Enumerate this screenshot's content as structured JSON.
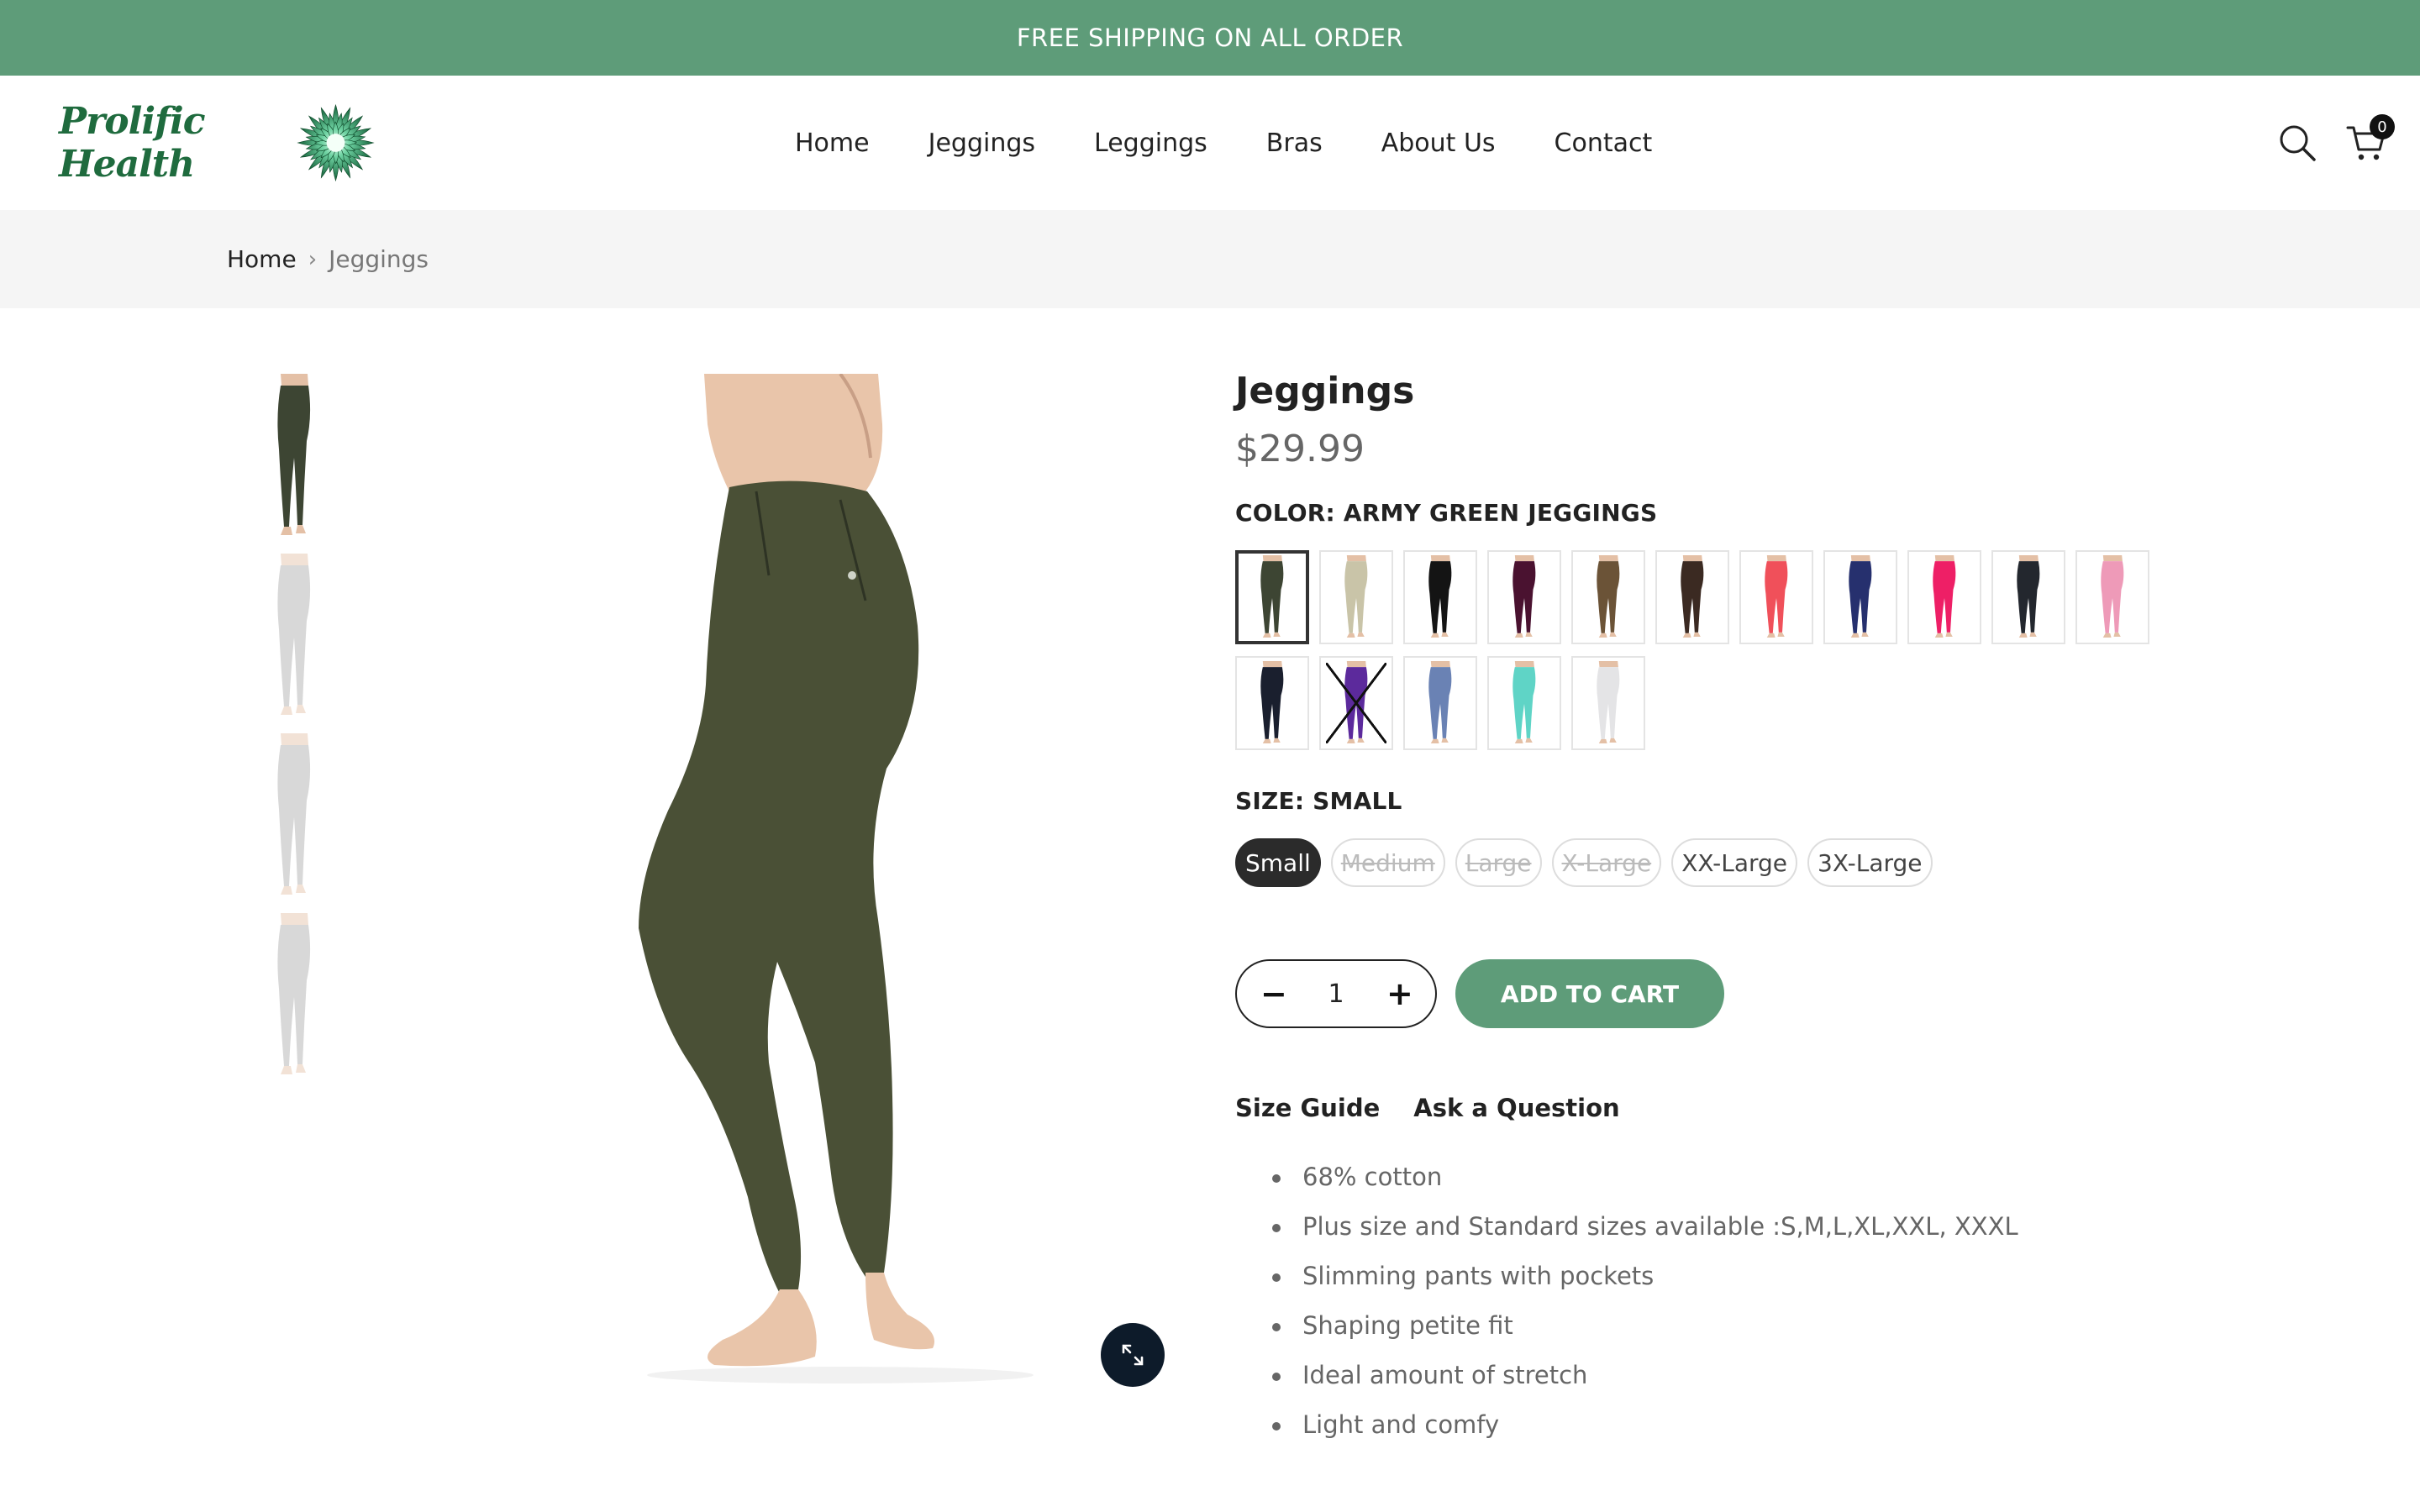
{
  "announcement": "FREE SHIPPING ON ALL ORDER",
  "brand": {
    "name": "Prolific Health",
    "accent": "#5e9c79",
    "dark_green": "#1f6b3e"
  },
  "nav": [
    {
      "label": "Home"
    },
    {
      "label": "Jeggings"
    },
    {
      "label": "Leggings"
    },
    {
      "label": "Bras"
    },
    {
      "label": "About Us"
    },
    {
      "label": "Contact"
    }
  ],
  "header_icons": {
    "search": "search-icon",
    "cart": "cart-icon",
    "cart_count": "0"
  },
  "breadcrumb": {
    "home": "Home",
    "current": "Jeggings"
  },
  "product": {
    "title": "Jeggings",
    "price": "$29.99",
    "color_label": "COLOR: ARMY GREEN JEGGINGS",
    "colors": [
      {
        "color": "#3d4533",
        "selected": true,
        "sold_out": false
      },
      {
        "color": "#c9c4a8",
        "selected": false,
        "sold_out": false
      },
      {
        "color": "#141414",
        "selected": false,
        "sold_out": false
      },
      {
        "color": "#4a1230",
        "selected": false,
        "sold_out": false
      },
      {
        "color": "#6b5337",
        "selected": false,
        "sold_out": false
      },
      {
        "color": "#3b2a22",
        "selected": false,
        "sold_out": false
      },
      {
        "color": "#f0505a",
        "selected": false,
        "sold_out": false
      },
      {
        "color": "#26306e",
        "selected": false,
        "sold_out": false
      },
      {
        "color": "#ee1f66",
        "selected": false,
        "sold_out": false
      },
      {
        "color": "#23272e",
        "selected": false,
        "sold_out": false
      },
      {
        "color": "#ee9ab8",
        "selected": false,
        "sold_out": false
      },
      {
        "color": "#1a1f2e",
        "selected": false,
        "sold_out": false
      },
      {
        "color": "#5c2a9c",
        "selected": false,
        "sold_out": true
      },
      {
        "color": "#6a82b4",
        "selected": false,
        "sold_out": false
      },
      {
        "color": "#5fd4c6",
        "selected": false,
        "sold_out": false
      },
      {
        "color": "#e4e4e6",
        "selected": false,
        "sold_out": false
      }
    ],
    "size_label": "SIZE: SMALL",
    "sizes": [
      {
        "label": "Small",
        "selected": true,
        "available": true
      },
      {
        "label": "Medium",
        "selected": false,
        "available": false
      },
      {
        "label": "Large",
        "selected": false,
        "available": false
      },
      {
        "label": "X-Large",
        "selected": false,
        "available": false
      },
      {
        "label": "XX-Large",
        "selected": false,
        "available": true
      },
      {
        "label": "3X-Large",
        "selected": false,
        "available": true
      }
    ],
    "quantity": "1",
    "add_to_cart": "ADD TO CART",
    "size_guide": "Size Guide",
    "ask_question": "Ask a Question",
    "features": [
      "68% cotton",
      "Plus size and Standard sizes available :S,M,L,XL,XXL, XXXL",
      "Slimming pants with pockets",
      "Shaping petite fit",
      "Ideal amount of stretch",
      "Light and comfy"
    ],
    "thumbnail_colors": [
      "#3d4533",
      "#a9a9a9",
      "#a9a9a9",
      "#a9a9a9"
    ],
    "main_color": "#4a5036"
  }
}
